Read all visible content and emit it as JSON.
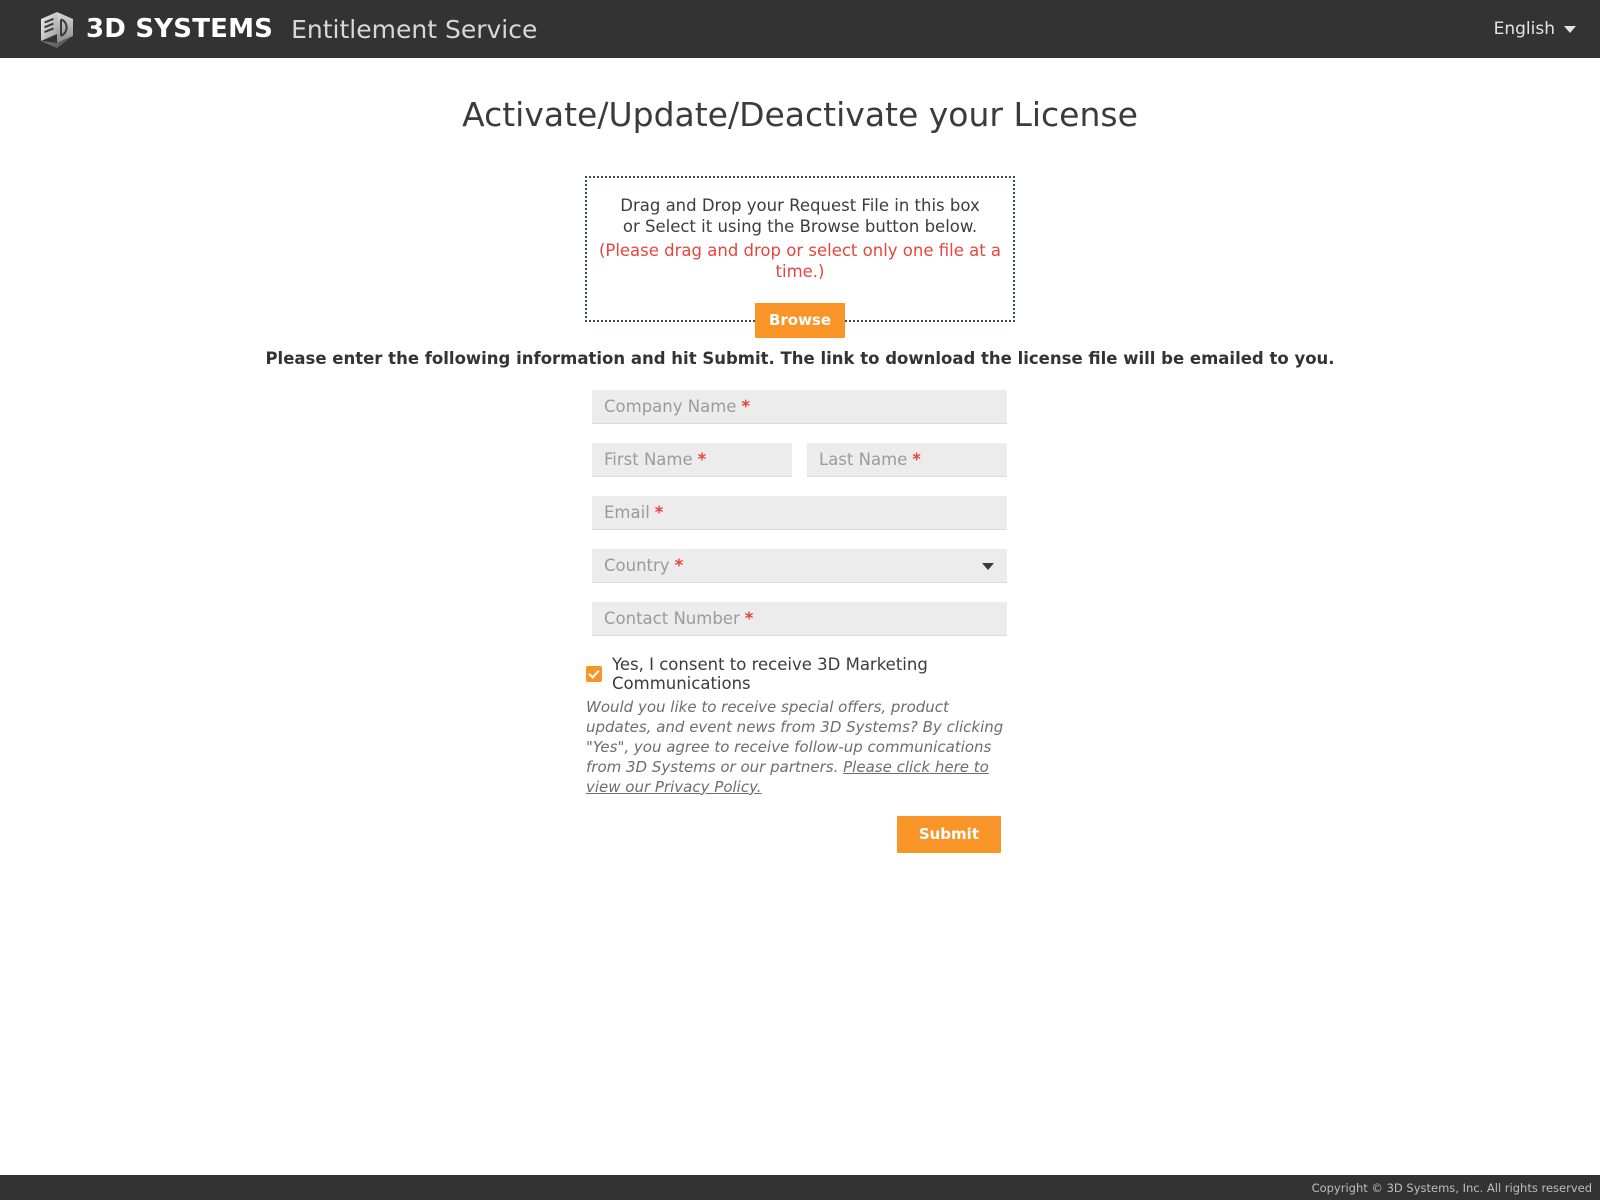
{
  "header": {
    "brand_name": "3D SYSTEMS",
    "app_name": "Entitlement Service",
    "logo_icon": "cube-3d-logo-icon",
    "language": {
      "selected": "English",
      "caret_icon": "chevron-down-icon"
    },
    "background_color": "#333333"
  },
  "page": {
    "title": "Activate/Update/Deactivate your License"
  },
  "dropzone": {
    "line1": "Drag and Drop your Request File in this box or Select it using the Browse button below.",
    "warning": "(Please drag and drop or select only one file at a time.)",
    "warning_color": "#e8453c",
    "browse_label": "Browse",
    "button_color": "#f89428"
  },
  "form": {
    "instruction": "Please enter the following information and hit Submit. The link to download the license file will be emailed to you.",
    "required_marker": "*",
    "fields": [
      {
        "name": "company-name",
        "placeholder": "Company Name",
        "value": "",
        "required": true
      },
      {
        "name": "first-name",
        "placeholder": "First Name",
        "value": "",
        "required": true
      },
      {
        "name": "last-name",
        "placeholder": "Last Name",
        "value": "",
        "required": true
      },
      {
        "name": "email",
        "placeholder": "Email",
        "value": "",
        "required": true
      },
      {
        "name": "country",
        "placeholder": "Country",
        "value": "",
        "required": true,
        "type": "select",
        "caret_icon": "chevron-down-icon"
      },
      {
        "name": "contact-number",
        "placeholder": "Contact Number",
        "value": "",
        "required": true
      }
    ],
    "consent": {
      "checked": true,
      "checkbox_color": "#f89428",
      "check_icon": "checkmark-icon",
      "label": "Yes, I consent to receive 3D Marketing Communications",
      "body": "Would you like to receive special offers, product updates, and event news from 3D Systems? By clicking \"Yes\", you agree to receive follow-up communications from 3D Systems or our partners. ",
      "privacy_link": "Please click here to view our Privacy Policy."
    },
    "submit_label": "Submit",
    "submit_color": "#f89428"
  },
  "footer": {
    "copyright": "Copyright © 3D Systems, Inc. All rights reserved",
    "background_color": "#333333"
  }
}
